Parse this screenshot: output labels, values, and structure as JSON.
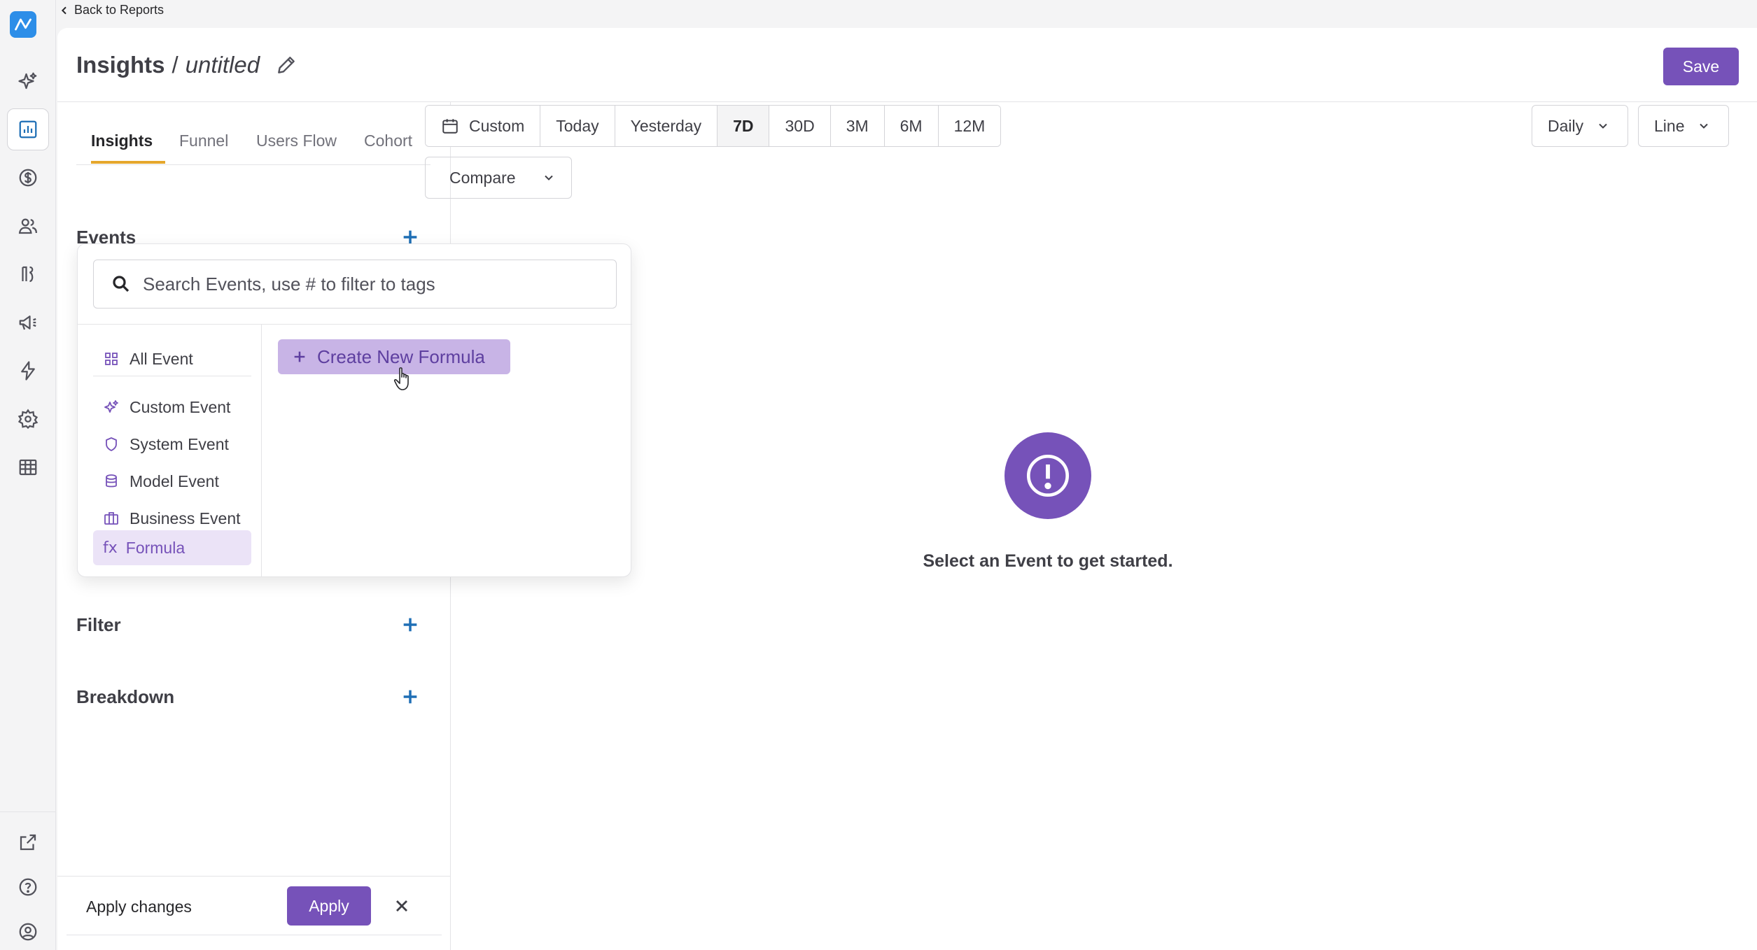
{
  "nav": {
    "back_label": "Back to Reports",
    "items": [
      {
        "icon": "sparkles-icon"
      },
      {
        "icon": "chart-report-icon",
        "active": true
      },
      {
        "icon": "dollar-icon"
      },
      {
        "icon": "users-icon"
      },
      {
        "icon": "flow-icon"
      },
      {
        "icon": "megaphone-icon"
      },
      {
        "icon": "lightning-icon"
      },
      {
        "icon": "gear-icon"
      },
      {
        "icon": "table-icon"
      }
    ],
    "bottom_items": [
      {
        "icon": "external-link-icon"
      },
      {
        "icon": "help-icon"
      },
      {
        "icon": "user-circle-icon"
      }
    ]
  },
  "header": {
    "title": "Insights",
    "separator": "/",
    "subtitle": "untitled",
    "save_label": "Save"
  },
  "panel": {
    "tabs": [
      {
        "label": "Insights",
        "active": true
      },
      {
        "label": "Funnel"
      },
      {
        "label": "Users Flow"
      },
      {
        "label": "Cohort"
      }
    ],
    "sections": {
      "events": "Events",
      "filter": "Filter",
      "breakdown": "Breakdown"
    },
    "apply_label": "Apply changes",
    "apply_button": "Apply"
  },
  "toolbar": {
    "ranges": [
      {
        "label": "Custom",
        "icon": "calendar-icon"
      },
      {
        "label": "Today"
      },
      {
        "label": "Yesterday"
      },
      {
        "label": "7D",
        "active": true
      },
      {
        "label": "30D"
      },
      {
        "label": "3M"
      },
      {
        "label": "6M"
      },
      {
        "label": "12M"
      }
    ],
    "interval": "Daily",
    "chart_type": "Line",
    "compare": "Compare"
  },
  "empty_state": {
    "icon": "alert-circle-icon",
    "message": "Select an Event to get started."
  },
  "event_picker": {
    "search_placeholder": "Search Events, use # to filter to tags",
    "categories": [
      {
        "label": "All Event",
        "icon": "grid-icon"
      },
      {
        "label": "Custom Event",
        "icon": "sparkles-icon"
      },
      {
        "label": "System Event",
        "icon": "shield-icon"
      },
      {
        "label": "Model Event",
        "icon": "database-icon"
      },
      {
        "label": "Business Event",
        "icon": "briefcase-icon"
      },
      {
        "label": "Formula",
        "icon_text": "fx",
        "active": true
      }
    ],
    "create_formula_label": "Create New Formula"
  },
  "colors": {
    "accent": "#7652b9",
    "tab_underline": "#e5a72c",
    "plus": "#1f6fb5",
    "logo": "#2d8ee8"
  }
}
